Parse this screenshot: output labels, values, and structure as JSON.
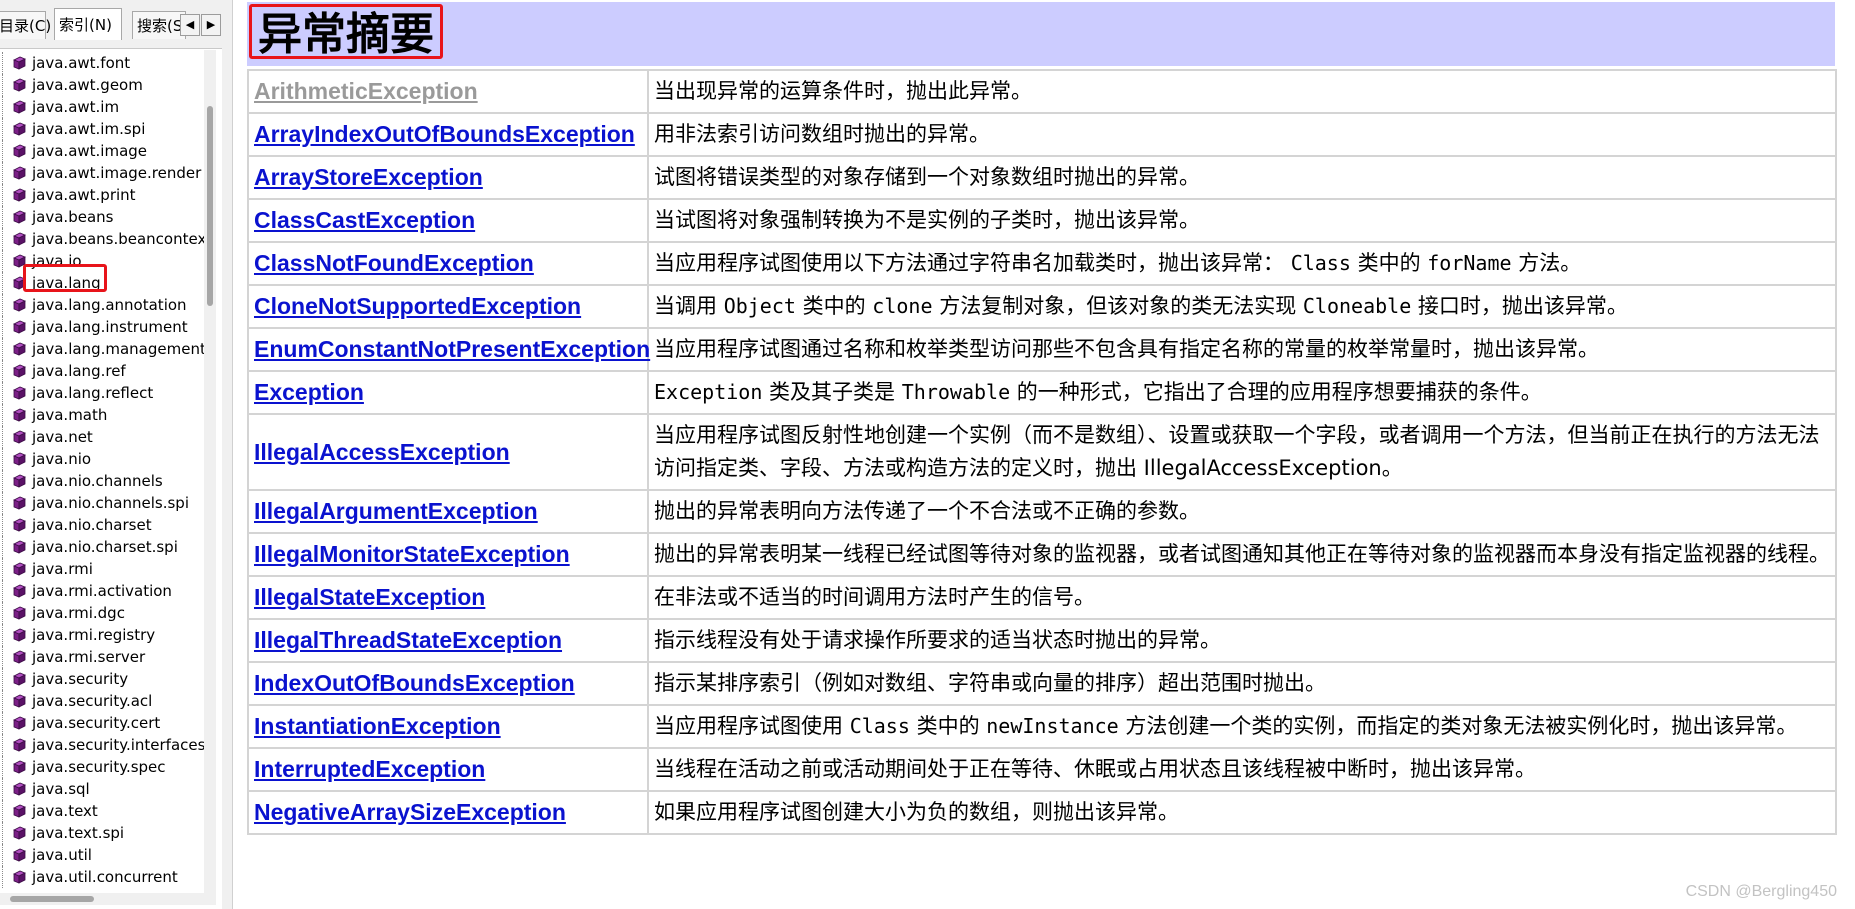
{
  "nav": {
    "tabs": [
      {
        "label": "目录(C)"
      },
      {
        "label": "索引(N)"
      },
      {
        "label": "搜索(S"
      }
    ],
    "scroll_left": "◀",
    "scroll_right": "▶",
    "packages": [
      "java.awt.font",
      "java.awt.geom",
      "java.awt.im",
      "java.awt.im.spi",
      "java.awt.image",
      "java.awt.image.render",
      "java.awt.print",
      "java.beans",
      "java.beans.beancontex",
      "java.io",
      "java.lang",
      "java.lang.annotation",
      "java.lang.instrument",
      "java.lang.management",
      "java.lang.ref",
      "java.lang.reflect",
      "java.math",
      "java.net",
      "java.nio",
      "java.nio.channels",
      "java.nio.channels.spi",
      "java.nio.charset",
      "java.nio.charset.spi",
      "java.rmi",
      "java.rmi.activation",
      "java.rmi.dgc",
      "java.rmi.registry",
      "java.rmi.server",
      "java.security",
      "java.security.acl",
      "java.security.cert",
      "java.security.interfaces",
      "java.security.spec",
      "java.sql",
      "java.text",
      "java.text.spi",
      "java.util",
      "java.util.concurrent"
    ],
    "selected": "java.lang"
  },
  "content": {
    "title": "异常摘要",
    "rows": [
      {
        "name": "ArithmeticException",
        "visited": true,
        "desc": [
          {
            "t": "当出现异常的运算条件时，抛出此异常。"
          }
        ]
      },
      {
        "name": "ArrayIndexOutOfBoundsException",
        "desc": [
          {
            "t": "用非法索引访问数组时抛出的异常。"
          }
        ]
      },
      {
        "name": "ArrayStoreException",
        "desc": [
          {
            "t": "试图将错误类型的对象存储到一个对象数组时抛出的异常。"
          }
        ]
      },
      {
        "name": "ClassCastException",
        "desc": [
          {
            "t": "当试图将对象强制转换为不是实例的子类时，抛出该异常。"
          }
        ]
      },
      {
        "name": "ClassNotFoundException",
        "desc": [
          {
            "t": "当应用程序试图使用以下方法通过字符串名加载类时，抛出该异常： "
          },
          {
            "c": "Class"
          },
          {
            "t": " 类中的 "
          },
          {
            "c": "forName"
          },
          {
            "t": " 方法。"
          }
        ]
      },
      {
        "name": "CloneNotSupportedException",
        "desc": [
          {
            "t": "当调用 "
          },
          {
            "c": "Object"
          },
          {
            "t": " 类中的 "
          },
          {
            "c": "clone"
          },
          {
            "t": " 方法复制对象，但该对象的类无法实现 "
          },
          {
            "c": "Cloneable"
          },
          {
            "t": " 接口时，抛出该异常。"
          }
        ]
      },
      {
        "name": "EnumConstantNotPresentException",
        "desc": [
          {
            "t": "当应用程序试图通过名称和枚举类型访问那些不包含具有指定名称的常量的枚举常量时，抛出该异常。"
          }
        ]
      },
      {
        "name": "Exception",
        "desc": [
          {
            "c": "Exception"
          },
          {
            "t": " 类及其子类是 "
          },
          {
            "c": "Throwable"
          },
          {
            "t": " 的一种形式，它指出了合理的应用程序想要捕获的条件。"
          }
        ]
      },
      {
        "name": "IllegalAccessException",
        "desc": [
          {
            "t": "当应用程序试图反射性地创建一个实例（而不是数组）、设置或获取一个字段，或者调用一个方法，但当前正在执行的方法无法访问指定类、字段、方法或构造方法的定义时，抛出 IllegalAccessException。"
          }
        ]
      },
      {
        "name": "IllegalArgumentException",
        "desc": [
          {
            "t": "抛出的异常表明向方法传递了一个不合法或不正确的参数。"
          }
        ]
      },
      {
        "name": "IllegalMonitorStateException",
        "desc": [
          {
            "t": "抛出的异常表明某一线程已经试图等待对象的监视器，或者试图通知其他正在等待对象的监视器而本身没有指定监视器的线程。"
          }
        ]
      },
      {
        "name": "IllegalStateException",
        "desc": [
          {
            "t": "在非法或不适当的时间调用方法时产生的信号。"
          }
        ]
      },
      {
        "name": "IllegalThreadStateException",
        "desc": [
          {
            "t": "指示线程没有处于请求操作所要求的适当状态时抛出的异常。"
          }
        ]
      },
      {
        "name": "IndexOutOfBoundsException",
        "desc": [
          {
            "t": "指示某排序索引（例如对数组、字符串或向量的排序）超出范围时抛出。"
          }
        ]
      },
      {
        "name": "InstantiationException",
        "desc": [
          {
            "t": "当应用程序试图使用 "
          },
          {
            "c": "Class"
          },
          {
            "t": " 类中的 "
          },
          {
            "c": "newInstance"
          },
          {
            "t": " 方法创建一个类的实例，而指定的类对象无法被实例化时，抛出该异常。"
          }
        ]
      },
      {
        "name": "InterruptedException",
        "desc": [
          {
            "t": "当线程在活动之前或活动期间处于正在等待、休眠或占用状态且该线程被中断时，抛出该异常。"
          }
        ]
      },
      {
        "name": "NegativeArraySizeException",
        "desc": [
          {
            "t": "如果应用程序试图创建大小为负的数组，则抛出该异常。"
          }
        ]
      }
    ]
  },
  "watermark": "CSDN @Bergling450",
  "colors": {
    "title_bar": "#ccccff",
    "link": "#0a12cf",
    "visited_link": "#9a9a9a",
    "annotation_red": "#e8141a",
    "book_icon": "#7b1f86"
  },
  "icons": {
    "package": "book-icon"
  }
}
